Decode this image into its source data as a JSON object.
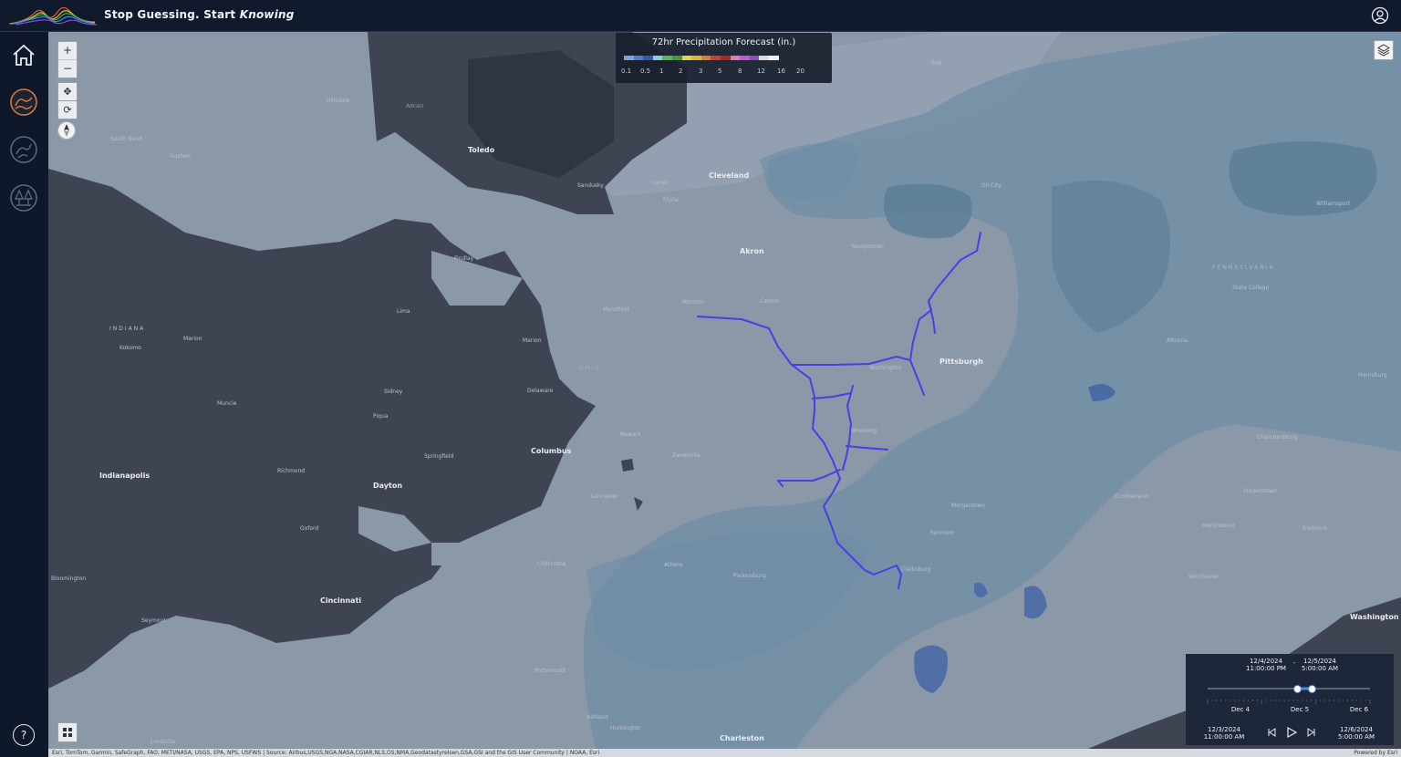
{
  "header": {
    "tagline_plain": "Stop Guessing. Start",
    "tagline_emph": "Knowing"
  },
  "sidebar": {
    "items": [
      {
        "name": "home-icon"
      },
      {
        "name": "flood-layer-icon"
      },
      {
        "name": "river-layer-icon"
      },
      {
        "name": "forest-layer-icon"
      },
      {
        "name": "help-icon",
        "label": "?"
      }
    ]
  },
  "map_controls": {
    "zoom_in": "+",
    "zoom_out": "−"
  },
  "legend": {
    "title": "72hr Precipitation Forecast (in.)",
    "ticks": [
      "0.1",
      "0.5",
      "1",
      "2",
      "3",
      "5",
      "8",
      "12",
      "16",
      "20"
    ],
    "colors": [
      "#7aa6d8",
      "#4d7fd1",
      "#3358b8",
      "#8fc9e0",
      "#5ab55a",
      "#3e9a3e",
      "#d8d84a",
      "#e0b23a",
      "#e07a2e",
      "#d43b2b",
      "#a8282e",
      "#e07ab8",
      "#c05ad8",
      "#8a4ec0",
      "#dcdcdc",
      "#f0f0f0"
    ]
  },
  "places": {
    "cleveland": "Cleveland",
    "toledo": "Toledo",
    "akron": "Akron",
    "pittsburgh": "Pittsburgh",
    "columbus": "Columbus",
    "dayton": "Dayton",
    "cincinnati": "Cincinnati",
    "indianapolis": "Indianapolis",
    "charleston": "Charleston",
    "washington": "Washington",
    "harrisburg": "Harrisburg",
    "indiana_state": "INDIANA",
    "ohio_state": "OHIO",
    "pennsylvania_state": "PENNSYLVANIA",
    "findlay": "Findlay",
    "lima": "Lima",
    "marion": "Marion",
    "mansfield": "Mansfield",
    "wooster": "Wooster",
    "canton": "Canton",
    "youngstown": "Youngstown",
    "newark": "Newark",
    "zanesville": "Zanesville",
    "wheeling": "Wheeling",
    "springfield": "Springfield",
    "richmond": "Richmond",
    "muncie": "Muncie",
    "kokomo": "Kokomo",
    "sidney": "Sidney",
    "piqua": "Piqua",
    "delaware": "Delaware",
    "lancaster": "Lancaster",
    "chillicothe": "Chillicothe",
    "athens": "Athens",
    "parkersburg": "Parkersburg",
    "morgantown": "Morgantown",
    "fairmont": "Fairmont",
    "clarksburg": "Clarksburg",
    "cumberland": "Cumberland",
    "hagerstown": "Hagerstown",
    "chambersburg": "Chambersburg",
    "altoona": "Altoona",
    "state_college": "State College",
    "erie": "Erie",
    "oil_city": "Oil City",
    "sandusky": "Sandusky",
    "lorain": "Lorain",
    "elyria": "Elyria",
    "ashland": "Ashland",
    "huntington": "Huntington",
    "portsmouth": "Portsmouth",
    "oxford": "Oxford",
    "bloomington": "Bloomington",
    "seymour": "Seymour",
    "louisville": "Louisville",
    "winchester": "Winchester",
    "frederick": "Frederick",
    "martinsburg": "Martinsburg",
    "williamsport": "Williamsport",
    "adrian": "Adrian",
    "hillsdale": "Hillsdale",
    "south_bend": "South Bend",
    "goshen": "Goshen",
    "marion_in": "Marion",
    "washington_pa": "Washington"
  },
  "time_slider": {
    "current_start_date": "12/4/2024",
    "current_start_time": "11:00:00 PM",
    "separator": "-",
    "current_end_date": "12/5/2024",
    "current_end_time": "5:00:00 AM",
    "ticks": [
      "Dec 4",
      "Dec 5",
      "Dec 6"
    ],
    "range_start_date": "12/3/2024",
    "range_start_time": "11:00:00 AM",
    "range_end_date": "12/6/2024",
    "range_end_time": "5:00:00 AM"
  },
  "attribution": {
    "sources": "Esri, TomTom, Garmin, SafeGraph, FAO, METI/NASA, USGS, EPA, NPS, USFWS | Source: Airbus,USGS,NGA,NASA,CGIAR,NLS,OS,NMA,Geodatastyrelsen,GSA,GSI and the GIS User Community | NOAA, Esri",
    "powered_by": "Powered by Esri"
  }
}
